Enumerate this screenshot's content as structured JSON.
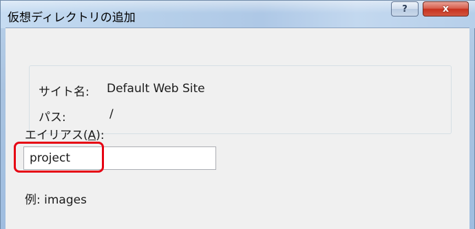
{
  "dialog": {
    "title": "仮想ディレクトリの追加",
    "help_glyph": "?",
    "close_glyph": "x"
  },
  "info": {
    "site_label": "サイト名:",
    "site_value": "Default Web Site",
    "path_label": "パス:",
    "path_value": "/"
  },
  "alias": {
    "label_prefix": "エイリアス(",
    "label_accel": "A",
    "label_suffix": "):",
    "value": "project",
    "example": "例: images"
  },
  "colors": {
    "highlight": "#e60012",
    "titlebar": "#b9d1ea",
    "client_bg": "#f0f0f0"
  }
}
